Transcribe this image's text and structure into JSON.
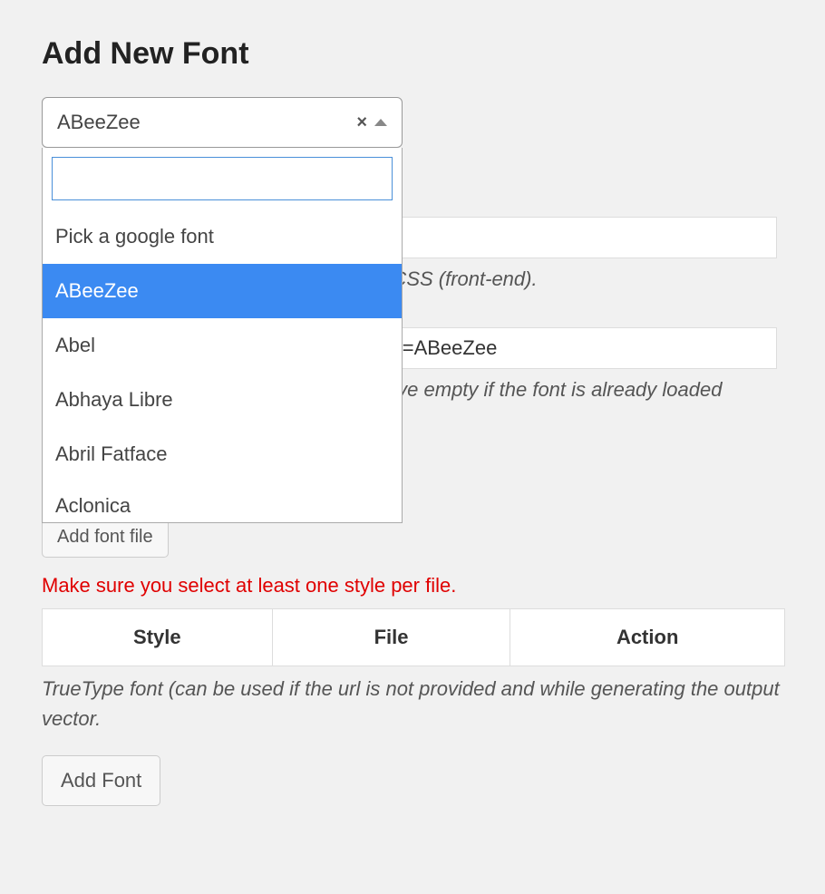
{
  "title": "Add New Font",
  "select": {
    "current": "ABeeZee",
    "placeholder_option": "Pick a google font",
    "options": [
      "ABeeZee",
      "Abel",
      "Abhaya Libre",
      "Abril Fatface",
      "Aclonica"
    ],
    "highlighted_index": 0
  },
  "name_field": {
    "value": "",
    "help": "Name of the font as it will appear in the CSS (front-end)."
  },
  "url_field": {
    "value": "https://fonts.googleapis.com/css?family=ABeeZee",
    "help": "URL to the font (e.g. Google Fonts). Leave empty if the font is already loaded"
  },
  "file_button": "Add font file",
  "error": "Make sure you select at least one style per file.",
  "table": {
    "headers": [
      "Style",
      "File",
      "Action"
    ]
  },
  "truetype_help": "TrueType font (can be used if the url is not provided and while generating the output vector.",
  "submit": "Add Font"
}
